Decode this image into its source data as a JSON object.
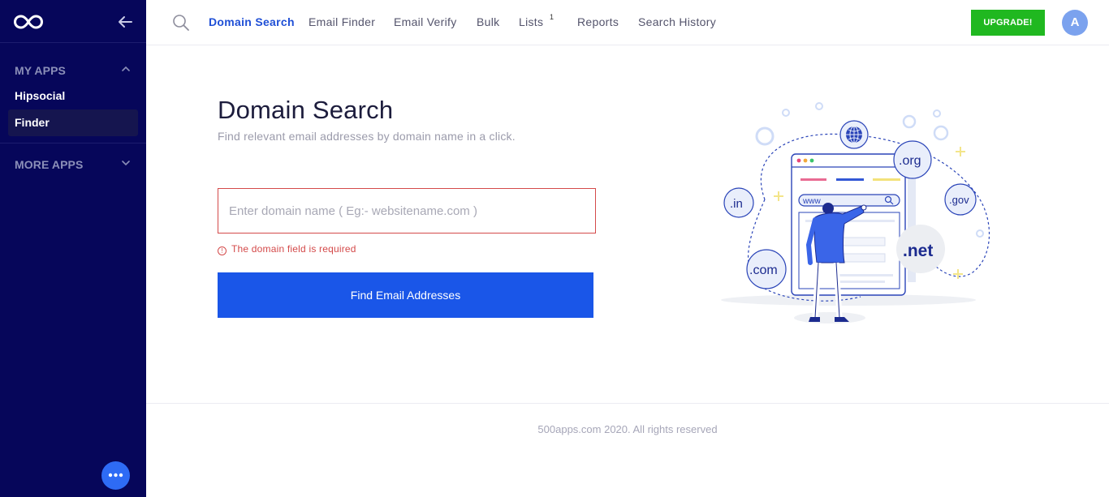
{
  "colors": {
    "sidebar_bg": "#06065a",
    "accent": "#1a56e8",
    "upgrade": "#20b820",
    "error": "#d44a4a"
  },
  "sidebar": {
    "logo_icon": "infinity-logo",
    "collapse_icon": "arrow-left-icon",
    "sections": [
      {
        "label": "MY APPS",
        "chevron": "chevron-up-icon",
        "items": [
          {
            "label": "Hipsocial",
            "active": false
          },
          {
            "label": "Finder",
            "active": true
          }
        ]
      },
      {
        "label": "MORE APPS",
        "chevron": "chevron-down-icon"
      }
    ],
    "fab_icon": "more-dots-icon"
  },
  "nav": {
    "search_icon": "search-icon",
    "items": [
      {
        "label": "Domain Search",
        "active": true
      },
      {
        "label": "Email Finder"
      },
      {
        "label": "Email Verify"
      },
      {
        "label": "Bulk"
      },
      {
        "label": "Lists",
        "badge": "1"
      },
      {
        "label": "Reports"
      },
      {
        "label": "Search History"
      }
    ],
    "upgrade_label": "UPGRADE!",
    "avatar_initial": "A"
  },
  "main": {
    "title": "Domain Search",
    "subtitle": "Find relevant email addresses by domain name in a click.",
    "input": {
      "placeholder": "Enter domain name ( Eg:- websitename.com )",
      "value": ""
    },
    "error": "The domain field is required",
    "error_icon": "!",
    "submit_label": "Find Email Addresses",
    "illustration": {
      "badges": [
        ".org",
        ".in",
        ".gov",
        ".com",
        ".net"
      ],
      "url_text": "www"
    }
  },
  "footer": {
    "copyright": "500apps.com 2020. All rights reserved"
  }
}
